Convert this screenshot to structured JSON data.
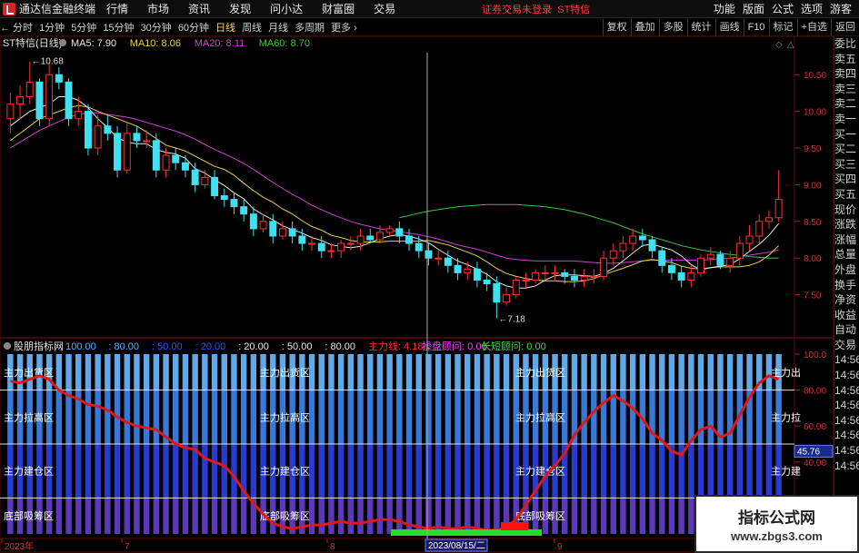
{
  "titlebar": {
    "app_title": "通达信金融终端",
    "menu": [
      "行情",
      "市场",
      "资讯",
      "发现",
      "问小达",
      "财富圈",
      "交易"
    ],
    "status": "证券交易未登录",
    "stock_name": "ST特信",
    "right_menu": [
      "功能",
      "版面",
      "公式",
      "选项"
    ],
    "guest": "游客"
  },
  "toolbar": {
    "periods": [
      "分时",
      "1分钟",
      "5分钟",
      "15分钟",
      "30分钟",
      "60分钟",
      "日线",
      "周线",
      "月线",
      "多周期",
      "更多"
    ],
    "active_period": "日线",
    "right_tools": [
      "复权",
      "叠加",
      "多股",
      "统计",
      "画线",
      "F10",
      "标记",
      "+自选",
      "返回"
    ]
  },
  "right_panel": [
    "委比",
    "卖五",
    "卖四",
    "卖三",
    "卖二",
    "卖一",
    "买一",
    "买二",
    "买三",
    "买四",
    "买五",
    "现价",
    "涨跌",
    "涨幅",
    "总量",
    "外盘",
    "换手",
    "净资",
    "收益",
    "自动",
    "交易",
    "14:56",
    "14:56",
    "14:56",
    "14:56",
    "14:56",
    "14:56",
    "14:56",
    "14:56"
  ],
  "main_chart": {
    "title": "ST特信(日线)",
    "ma_labels": [
      {
        "text": "MA5: 7.90",
        "color": "#e8e8e8"
      },
      {
        "text": "MA10: 8.06",
        "color": "#e8d24a"
      },
      {
        "text": "MA20: 8.11",
        "color": "#d040d0"
      },
      {
        "text": "MA60: 8.70",
        "color": "#40c040"
      }
    ],
    "y_ticks": [
      "10.50",
      "10.00",
      "9.50",
      "9.00",
      "8.50",
      "8.00",
      "7.50"
    ],
    "high_label": "10.68",
    "low_label": "7.18"
  },
  "indicator": {
    "title": "股朋指标网",
    "params": [
      {
        "text": ": 100.00",
        "color": "#5ab0ff"
      },
      {
        "text": ": 80.00",
        "color": "#5ab0ff"
      },
      {
        "text": ": 50.00",
        "color": "#3050ff"
      },
      {
        "text": ": 20.00",
        "color": "#3050ff"
      },
      {
        "text": ": 20.00",
        "color": "#e8e8e8"
      },
      {
        "text": ": 50.00",
        "color": "#e8e8e8"
      },
      {
        "text": ": 80.00",
        "color": "#e8e8e8"
      },
      {
        "text": "主力线: 4.18",
        "color": "#ff3030"
      },
      {
        "text": "操盘顾问: 0.00",
        "color": "#ff40ff"
      },
      {
        "text": "长短顾问: 0.00",
        "color": "#40e040"
      }
    ],
    "zone_labels": [
      "主力出货区",
      "主力拉高区",
      "主力建仓区",
      "底部吸筹区"
    ],
    "right_zone_labels": [
      "主力出",
      "主力拉",
      "主力建"
    ],
    "y_ticks": [
      "100.0",
      "80.00",
      "60.00",
      "40.00",
      "20.00"
    ],
    "current_value": "45.76"
  },
  "time_axis": {
    "labels": [
      "2023年",
      "7",
      "8",
      "9"
    ],
    "crosshair_date": "2023/08/15/二"
  },
  "watermark": {
    "title": "指标公式网",
    "url": "www.zbgs3.com"
  },
  "colors": {
    "up": "#ff3030",
    "down": "#40e0f0",
    "ma5": "#e8e8e8",
    "ma10": "#e8d24a",
    "ma20": "#d040d0",
    "ma60": "#40c040",
    "main_line": "#e01818"
  },
  "chart_data": {
    "type": "candlestick",
    "x": [
      "2023-06-01",
      "2023-06-02",
      "2023-06-05",
      "2023-06-06",
      "2023-06-07",
      "2023-06-08",
      "2023-06-09",
      "2023-06-12",
      "2023-06-13",
      "2023-06-14",
      "2023-06-15",
      "2023-06-16",
      "2023-06-19",
      "2023-06-20",
      "2023-06-21",
      "2023-06-26",
      "2023-06-27",
      "2023-06-28",
      "2023-06-29",
      "2023-06-30",
      "2023-07-03",
      "2023-07-04",
      "2023-07-05",
      "2023-07-06",
      "2023-07-07",
      "2023-07-10",
      "2023-07-11",
      "2023-07-12",
      "2023-07-13",
      "2023-07-14",
      "2023-07-17",
      "2023-07-18",
      "2023-07-19",
      "2023-07-20",
      "2023-07-21",
      "2023-07-24",
      "2023-07-25",
      "2023-07-26",
      "2023-07-27",
      "2023-07-28",
      "2023-07-31",
      "2023-08-01",
      "2023-08-02",
      "2023-08-03",
      "2023-08-04",
      "2023-08-07",
      "2023-08-08",
      "2023-08-09",
      "2023-08-10",
      "2023-08-11",
      "2023-08-14",
      "2023-08-15",
      "2023-08-16",
      "2023-08-17",
      "2023-08-18",
      "2023-08-21",
      "2023-08-22",
      "2023-08-23",
      "2023-08-24",
      "2023-08-25",
      "2023-08-28",
      "2023-08-29",
      "2023-08-30",
      "2023-08-31",
      "2023-09-01",
      "2023-09-04",
      "2023-09-05",
      "2023-09-06",
      "2023-09-07",
      "2023-09-08",
      "2023-09-11",
      "2023-09-12",
      "2023-09-13",
      "2023-09-14",
      "2023-09-15",
      "2023-09-18",
      "2023-09-19",
      "2023-09-20",
      "2023-09-21",
      "2023-09-22"
    ],
    "open": [
      9.9,
      10.1,
      10.2,
      10.4,
      9.9,
      10.5,
      10.4,
      9.9,
      10.0,
      9.5,
      9.8,
      9.7,
      9.2,
      9.7,
      9.6,
      9.6,
      9.2,
      9.4,
      9.3,
      9.2,
      9.0,
      9.1,
      8.85,
      8.8,
      8.7,
      8.6,
      8.4,
      8.5,
      8.3,
      8.4,
      8.3,
      8.2,
      8.2,
      8.1,
      8.1,
      8.2,
      8.2,
      8.3,
      8.25,
      8.35,
      8.4,
      8.3,
      8.2,
      8.1,
      8.0,
      8.0,
      7.9,
      7.8,
      7.85,
      7.7,
      7.65,
      7.4,
      7.5,
      7.7,
      7.7,
      7.8,
      7.8,
      7.8,
      7.75,
      7.7,
      7.75,
      7.75,
      8.0,
      8.1,
      8.2,
      8.3,
      8.25,
      8.1,
      7.9,
      7.8,
      7.7,
      7.8,
      8.0,
      8.05,
      7.9,
      8.0,
      8.2,
      8.3,
      8.5,
      8.55
    ],
    "close": [
      10.1,
      10.2,
      10.4,
      9.9,
      10.5,
      10.4,
      9.9,
      10.0,
      9.5,
      9.8,
      9.7,
      9.2,
      9.7,
      9.6,
      9.6,
      9.2,
      9.4,
      9.3,
      9.2,
      9.0,
      9.1,
      8.85,
      8.8,
      8.7,
      8.6,
      8.4,
      8.5,
      8.3,
      8.4,
      8.3,
      8.2,
      8.2,
      8.1,
      8.1,
      8.2,
      8.2,
      8.3,
      8.25,
      8.35,
      8.4,
      8.3,
      8.2,
      8.1,
      8.0,
      8.0,
      7.9,
      7.8,
      7.85,
      7.7,
      7.65,
      7.4,
      7.5,
      7.7,
      7.7,
      7.8,
      7.8,
      7.8,
      7.75,
      7.7,
      7.75,
      7.75,
      8.0,
      8.1,
      8.2,
      8.3,
      8.25,
      8.1,
      7.9,
      7.8,
      7.7,
      7.8,
      8.0,
      8.05,
      7.9,
      8.0,
      8.2,
      8.3,
      8.5,
      8.55,
      8.8
    ],
    "high": [
      10.25,
      10.35,
      10.68,
      10.45,
      10.65,
      10.6,
      10.45,
      10.2,
      10.1,
      9.95,
      9.95,
      9.8,
      9.85,
      9.8,
      9.75,
      9.7,
      9.5,
      9.5,
      9.4,
      9.3,
      9.2,
      9.2,
      8.95,
      8.9,
      8.8,
      8.7,
      8.6,
      8.6,
      8.5,
      8.5,
      8.4,
      8.3,
      8.3,
      8.2,
      8.25,
      8.3,
      8.4,
      8.4,
      8.45,
      8.45,
      8.5,
      8.4,
      8.3,
      8.2,
      8.1,
      8.1,
      8.0,
      7.95,
      7.95,
      7.8,
      7.75,
      7.6,
      7.75,
      7.8,
      7.85,
      7.9,
      7.9,
      7.85,
      7.85,
      7.85,
      7.85,
      8.1,
      8.2,
      8.3,
      8.4,
      8.4,
      8.3,
      8.15,
      8.0,
      7.9,
      7.9,
      8.05,
      8.15,
      8.1,
      8.1,
      8.3,
      8.45,
      8.6,
      8.65,
      9.2
    ],
    "low": [
      9.7,
      9.9,
      10.1,
      9.8,
      9.8,
      10.3,
      9.8,
      9.8,
      9.4,
      9.4,
      9.6,
      9.1,
      9.15,
      9.5,
      9.5,
      9.1,
      9.1,
      9.2,
      9.1,
      8.9,
      8.95,
      8.8,
      8.7,
      8.6,
      8.5,
      8.3,
      8.35,
      8.2,
      8.25,
      8.2,
      8.1,
      8.1,
      8.0,
      8.0,
      8.0,
      8.1,
      8.1,
      8.2,
      8.2,
      8.3,
      8.2,
      8.1,
      8.0,
      7.9,
      7.9,
      7.8,
      7.7,
      7.7,
      7.6,
      7.55,
      7.18,
      7.35,
      7.45,
      7.6,
      7.65,
      7.7,
      7.7,
      7.65,
      7.6,
      7.6,
      7.65,
      7.7,
      7.9,
      8.0,
      8.1,
      8.15,
      8.0,
      7.8,
      7.7,
      7.6,
      7.6,
      7.75,
      7.9,
      7.85,
      7.8,
      7.9,
      8.1,
      8.2,
      8.4,
      8.5
    ],
    "ma5": [
      9.8,
      9.9,
      10.0,
      10.05,
      10.1,
      10.2,
      10.2,
      10.15,
      10.05,
      9.9,
      9.78,
      9.64,
      9.58,
      9.56,
      9.56,
      9.48,
      9.44,
      9.42,
      9.36,
      9.22,
      9.16,
      9.07,
      8.99,
      8.89,
      8.81,
      8.67,
      8.59,
      8.52,
      8.44,
      8.39,
      8.34,
      8.28,
      8.24,
      8.18,
      8.16,
      8.14,
      8.16,
      8.21,
      8.26,
      8.3,
      8.32,
      8.3,
      8.26,
      8.21,
      8.12,
      8.04,
      7.96,
      7.91,
      7.85,
      7.78,
      7.68,
      7.62,
      7.59,
      7.59,
      7.62,
      7.7,
      7.76,
      7.77,
      7.77,
      7.76,
      7.75,
      7.79,
      7.86,
      7.96,
      8.07,
      8.17,
      8.19,
      8.15,
      8.11,
      8.03,
      7.91,
      7.84,
      7.87,
      7.89,
      7.91,
      7.99,
      8.09,
      8.19,
      8.31,
      8.47
    ],
    "ma10": [
      9.6,
      9.7,
      9.8,
      9.9,
      9.95,
      10.0,
      10.05,
      10.08,
      10.06,
      10.0,
      9.95,
      9.9,
      9.85,
      9.8,
      9.72,
      9.63,
      9.54,
      9.5,
      9.46,
      9.39,
      9.32,
      9.25,
      9.21,
      9.13,
      9.02,
      8.92,
      8.83,
      8.76,
      8.67,
      8.6,
      8.51,
      8.43,
      8.38,
      8.31,
      8.28,
      8.24,
      8.22,
      8.22,
      8.22,
      8.23,
      8.23,
      8.23,
      8.23,
      8.24,
      8.21,
      8.18,
      8.13,
      8.08,
      8.03,
      7.95,
      7.86,
      7.79,
      7.75,
      7.72,
      7.7,
      7.69,
      7.69,
      7.68,
      7.68,
      7.69,
      7.72,
      7.77,
      7.82,
      7.86,
      7.91,
      7.96,
      7.98,
      7.96,
      7.94,
      7.89,
      7.86,
      7.85,
      7.87,
      7.88,
      7.88,
      7.88,
      7.9,
      7.95,
      8.04,
      8.17
    ],
    "ma20": [
      9.5,
      9.58,
      9.66,
      9.74,
      9.8,
      9.86,
      9.92,
      9.96,
      9.98,
      9.98,
      9.96,
      9.94,
      9.92,
      9.89,
      9.85,
      9.81,
      9.77,
      9.73,
      9.68,
      9.62,
      9.55,
      9.48,
      9.42,
      9.36,
      9.29,
      9.21,
      9.12,
      9.03,
      8.95,
      8.87,
      8.8,
      8.72,
      8.66,
      8.6,
      8.55,
      8.5,
      8.46,
      8.43,
      8.4,
      8.38,
      8.36,
      8.34,
      8.32,
      8.29,
      8.26,
      8.22,
      8.18,
      8.15,
      8.12,
      8.08,
      8.04,
      8.0,
      7.98,
      7.97,
      7.96,
      7.96,
      7.96,
      7.96,
      7.96,
      7.95,
      7.94,
      7.93,
      7.93,
      7.94,
      7.95,
      7.96,
      7.97,
      7.97,
      7.97,
      7.97,
      7.97,
      7.97,
      7.98,
      7.99,
      8.0,
      8.02,
      8.04,
      8.06,
      8.08,
      8.11
    ],
    "ma60": [
      null,
      null,
      null,
      null,
      null,
      null,
      null,
      null,
      null,
      null,
      null,
      null,
      null,
      null,
      null,
      null,
      null,
      null,
      null,
      null,
      null,
      null,
      null,
      null,
      null,
      null,
      null,
      null,
      null,
      null,
      null,
      null,
      null,
      null,
      null,
      null,
      null,
      null,
      null,
      null,
      8.55,
      8.58,
      8.61,
      8.64,
      8.66,
      8.68,
      8.7,
      8.71,
      8.72,
      8.73,
      8.73,
      8.73,
      8.73,
      8.72,
      8.71,
      8.7,
      8.68,
      8.66,
      8.63,
      8.6,
      8.56,
      8.52,
      8.48,
      8.43,
      8.38,
      8.33,
      8.29,
      8.25,
      8.21,
      8.17,
      8.14,
      8.11,
      8.09,
      8.07,
      8.05,
      8.04,
      8.02,
      8.01,
      8.0,
      8.0
    ],
    "main_line": [
      85,
      84,
      86,
      88,
      86,
      80,
      77,
      75,
      72,
      71,
      69,
      65,
      62,
      60,
      59,
      58,
      54,
      50,
      48,
      47,
      42,
      40,
      38,
      32,
      24,
      17,
      11,
      6,
      4,
      3,
      4,
      5,
      5,
      6,
      7,
      6,
      6,
      7,
      8,
      8,
      7,
      5,
      4,
      3,
      4,
      3,
      3,
      4,
      3,
      2,
      2,
      4,
      8,
      16,
      24,
      32,
      38,
      45,
      55,
      62,
      68,
      73,
      77,
      74,
      70,
      64,
      56,
      52,
      46,
      44,
      52,
      58,
      60,
      54,
      56,
      66,
      76,
      84,
      88,
      86
    ],
    "ylim": [
      7.0,
      10.8
    ],
    "indicator_ylim": [
      0,
      100
    ]
  }
}
